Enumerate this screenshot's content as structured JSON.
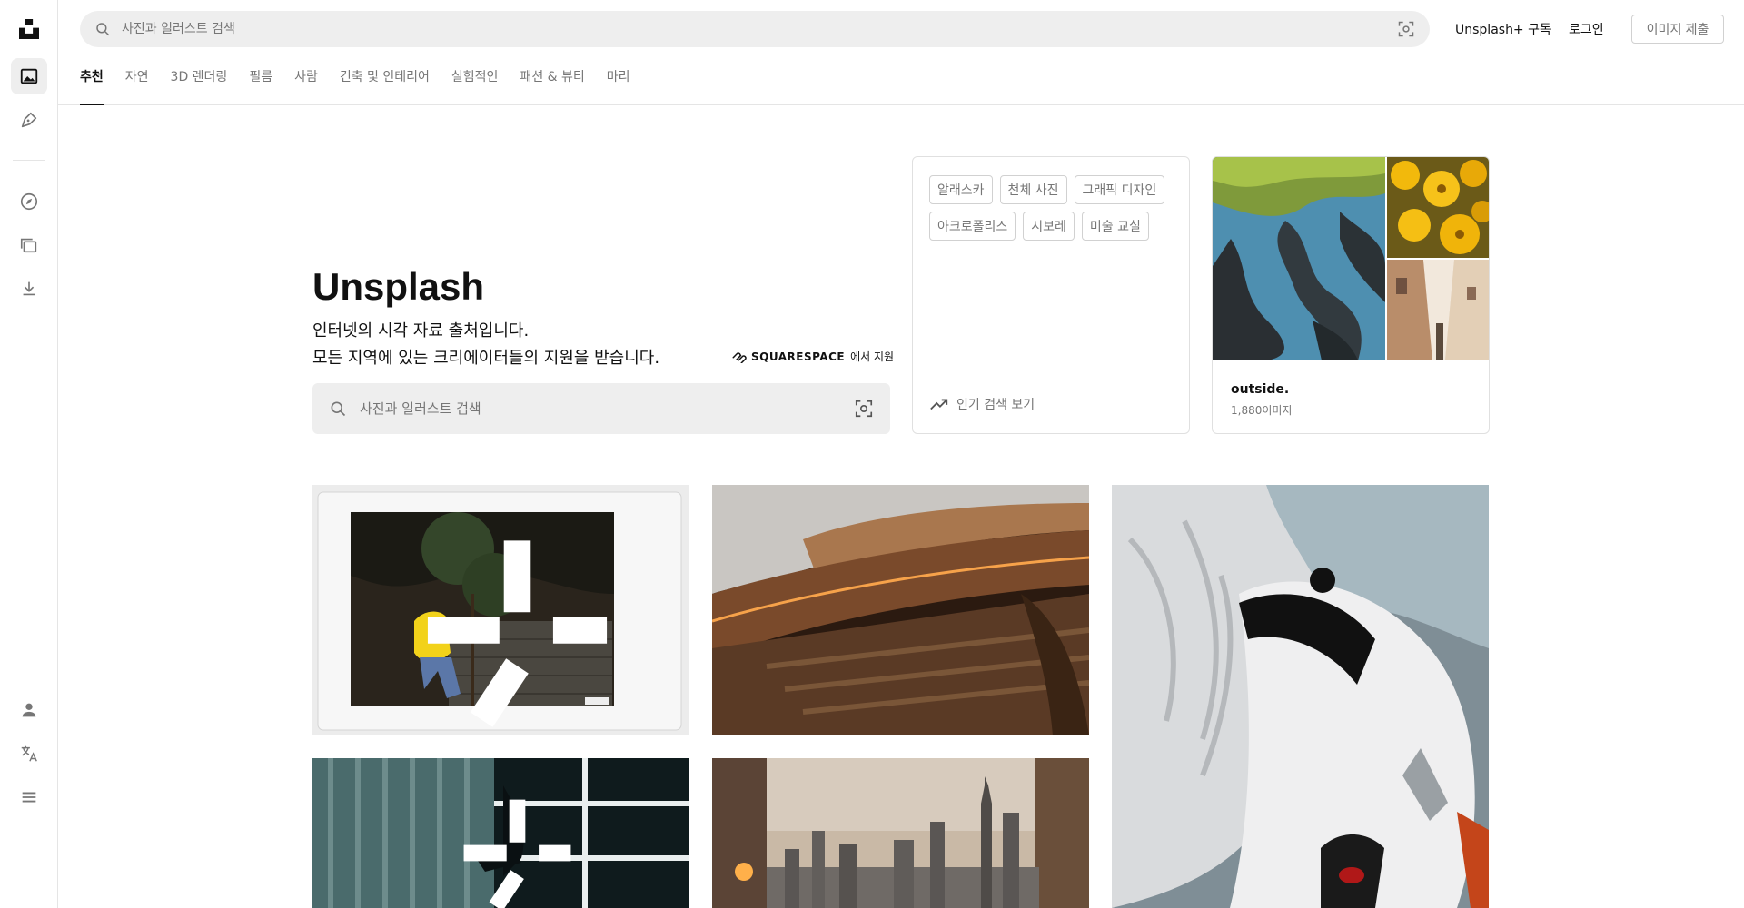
{
  "header": {
    "search_placeholder": "사진과 일러스트 검색",
    "subscribe_label": "Unsplash+ 구독",
    "login_label": "로그인",
    "submit_label": "이미지 제출"
  },
  "categories": [
    {
      "label": "추천",
      "active": true
    },
    {
      "label": "자연",
      "active": false
    },
    {
      "label": "3D 렌더링",
      "active": false
    },
    {
      "label": "필름",
      "active": false
    },
    {
      "label": "사람",
      "active": false
    },
    {
      "label": "건축 및 인테리어",
      "active": false
    },
    {
      "label": "실험적인",
      "active": false
    },
    {
      "label": "패션 & 뷰티",
      "active": false
    },
    {
      "label": "마리",
      "active": false
    }
  ],
  "hero": {
    "title": "Unsplash",
    "subtitle_line1": "인터넷의 시각 자료 출처입니다.",
    "subtitle_line2": "모든 지역에 있는 크리에이터들의 지원을 받습니다.",
    "sponsor_name": "SQUARESPACE",
    "sponsor_suffix": "에서 지원",
    "search_placeholder": "사진과 일러스트 검색"
  },
  "trending": {
    "chips": [
      "알래스카",
      "천체 사진",
      "그래픽 디자인",
      "아크로폴리스",
      "시보레",
      "미술 교실"
    ],
    "link_label": "인기 검색 보기"
  },
  "collection": {
    "title": "outside.",
    "count": "1,880이미지"
  },
  "colors": {
    "accent": "#111111",
    "muted": "#767676",
    "search_bg": "#eeeeee",
    "border": "#e0e0e0"
  }
}
